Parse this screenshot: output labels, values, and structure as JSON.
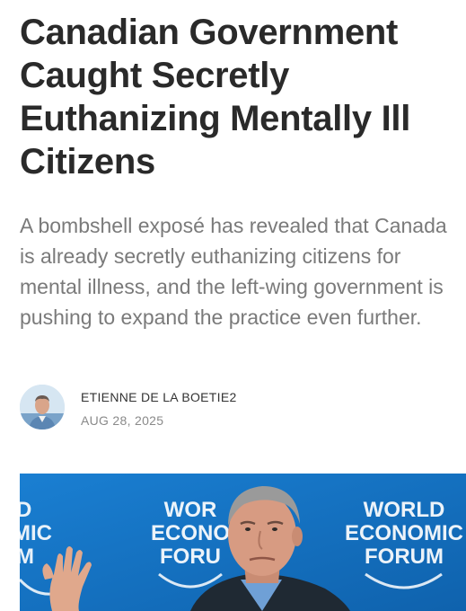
{
  "article": {
    "headline": "Canadian Government Caught Secretly Euthanizing Mentally Ill Citizens",
    "subtitle": "A bombshell exposé has revealed that Canada is already secretly euthanizing citizens for mental illness, and the left-wing government is pushing to expand the practice even further.",
    "author": {
      "name": "ETIENNE DE LA BOETIE2",
      "date": "AUG 28, 2025"
    },
    "hero_image": {
      "backdrop_text_left": [
        "WOR",
        "ECONO",
        "FORU"
      ],
      "backdrop_text_right": [
        "WORLD",
        "ECONOMIC",
        "FORUM"
      ],
      "backdrop_text_edge": [
        "D",
        "MIC",
        "M"
      ]
    }
  },
  "colors": {
    "headline": "#2a2a2a",
    "subtitle": "#7a7a7a",
    "hero_backdrop": "#1476c8"
  }
}
